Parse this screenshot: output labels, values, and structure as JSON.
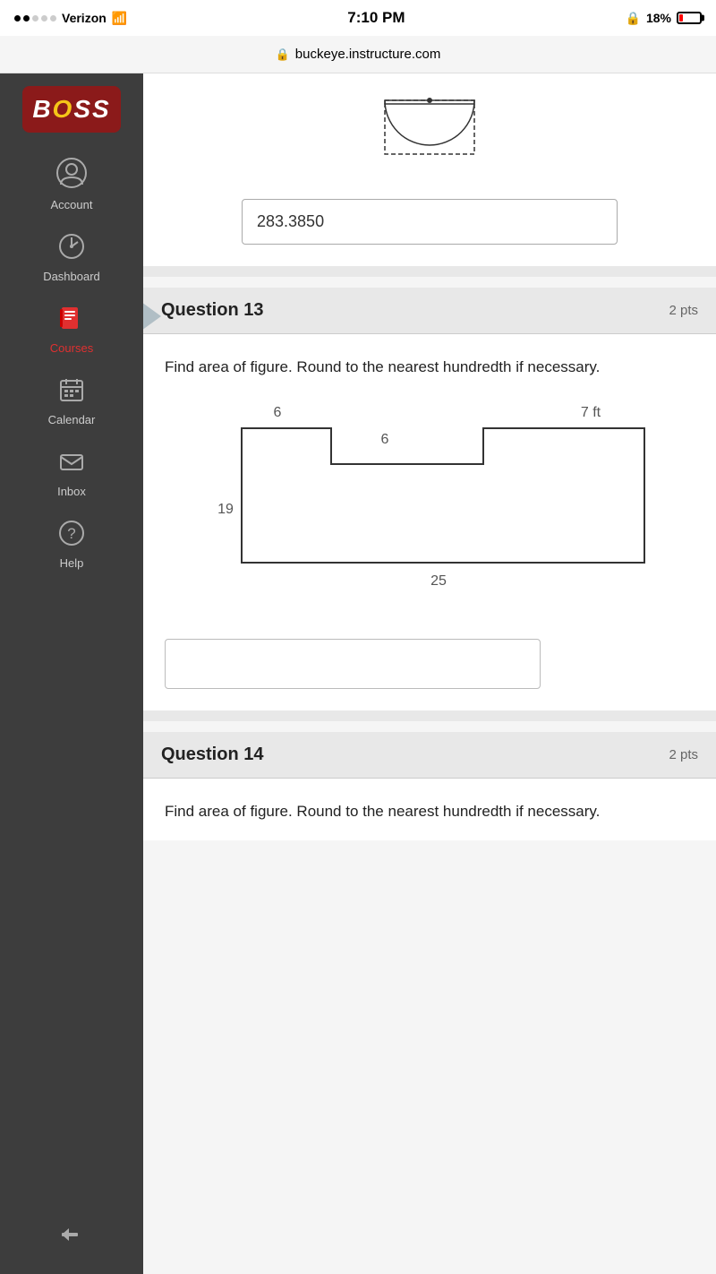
{
  "statusBar": {
    "carrier": "Verizon",
    "signal": "wifi",
    "time": "7:10 PM",
    "battery": "18%",
    "lock": true
  },
  "urlBar": {
    "url": "buckeye.instructure.com",
    "secure": true
  },
  "sidebar": {
    "logo": "BOSS",
    "items": [
      {
        "id": "account",
        "label": "Account",
        "icon": "👤"
      },
      {
        "id": "dashboard",
        "label": "Dashboard",
        "icon": "🕐"
      },
      {
        "id": "courses",
        "label": "Courses",
        "icon": "📋",
        "active": true
      },
      {
        "id": "calendar",
        "label": "Calendar",
        "icon": "📅"
      },
      {
        "id": "inbox",
        "label": "Inbox",
        "icon": "✉"
      },
      {
        "id": "help",
        "label": "Help",
        "icon": "❓"
      }
    ],
    "collapseLabel": "Collapse",
    "collapseIcon": "←"
  },
  "previousQuestion": {
    "answerValue": "283.3850"
  },
  "questions": [
    {
      "id": "q13",
      "number": "Question 13",
      "points": "2",
      "instruction": "Find area of figure. Round to the nearest hundredth if necessary.",
      "figure": {
        "type": "L-notch",
        "labels": {
          "top": "6",
          "innerTop": "6",
          "right": "7 ft",
          "left": "19",
          "bottom": "25"
        }
      },
      "answerPlaceholder": ""
    },
    {
      "id": "q14",
      "number": "Question 14",
      "points": "2",
      "instruction": "Find area of figure. Round to the nearest hundredth if necessary.",
      "answerPlaceholder": ""
    }
  ]
}
